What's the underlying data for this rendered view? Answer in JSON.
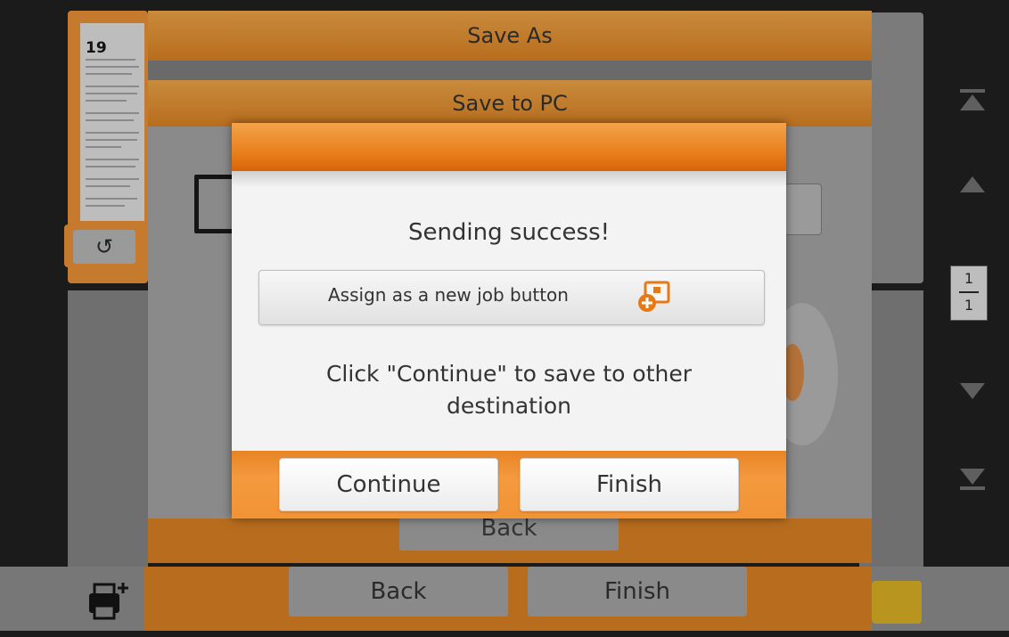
{
  "app": {
    "thumbnail": {
      "page_number": "19"
    },
    "save_as": {
      "title": "Save As"
    },
    "save_to_pc": {
      "title": "Save to PC"
    },
    "inner_back_label": "Back",
    "bottom_bar": {
      "back_label": "Back",
      "finish_label": "Finish"
    },
    "page_indicator": {
      "current": "1",
      "total": "1"
    },
    "icons": {
      "rotate": "rotate-icon",
      "monitor": "monitor-icon",
      "printer": "printer-add-icon",
      "scroll_top": "scroll-top-icon",
      "scroll_up": "scroll-up-icon",
      "scroll_down": "scroll-down-icon",
      "scroll_bottom": "scroll-bottom-icon"
    }
  },
  "dialog": {
    "message": "Sending success!",
    "assign_button_label": "Assign as a new job button",
    "assign_button_icon": "add-job-icon",
    "hint_line1": "Click \"Continue\" to save to other",
    "hint_line2": "destination",
    "continue_label": "Continue",
    "finish_label": "Finish"
  },
  "colors": {
    "accent_orange": "#f08a24",
    "dialog_background": "#f3f3f3",
    "dimmed_orange": "#b86d1e"
  }
}
